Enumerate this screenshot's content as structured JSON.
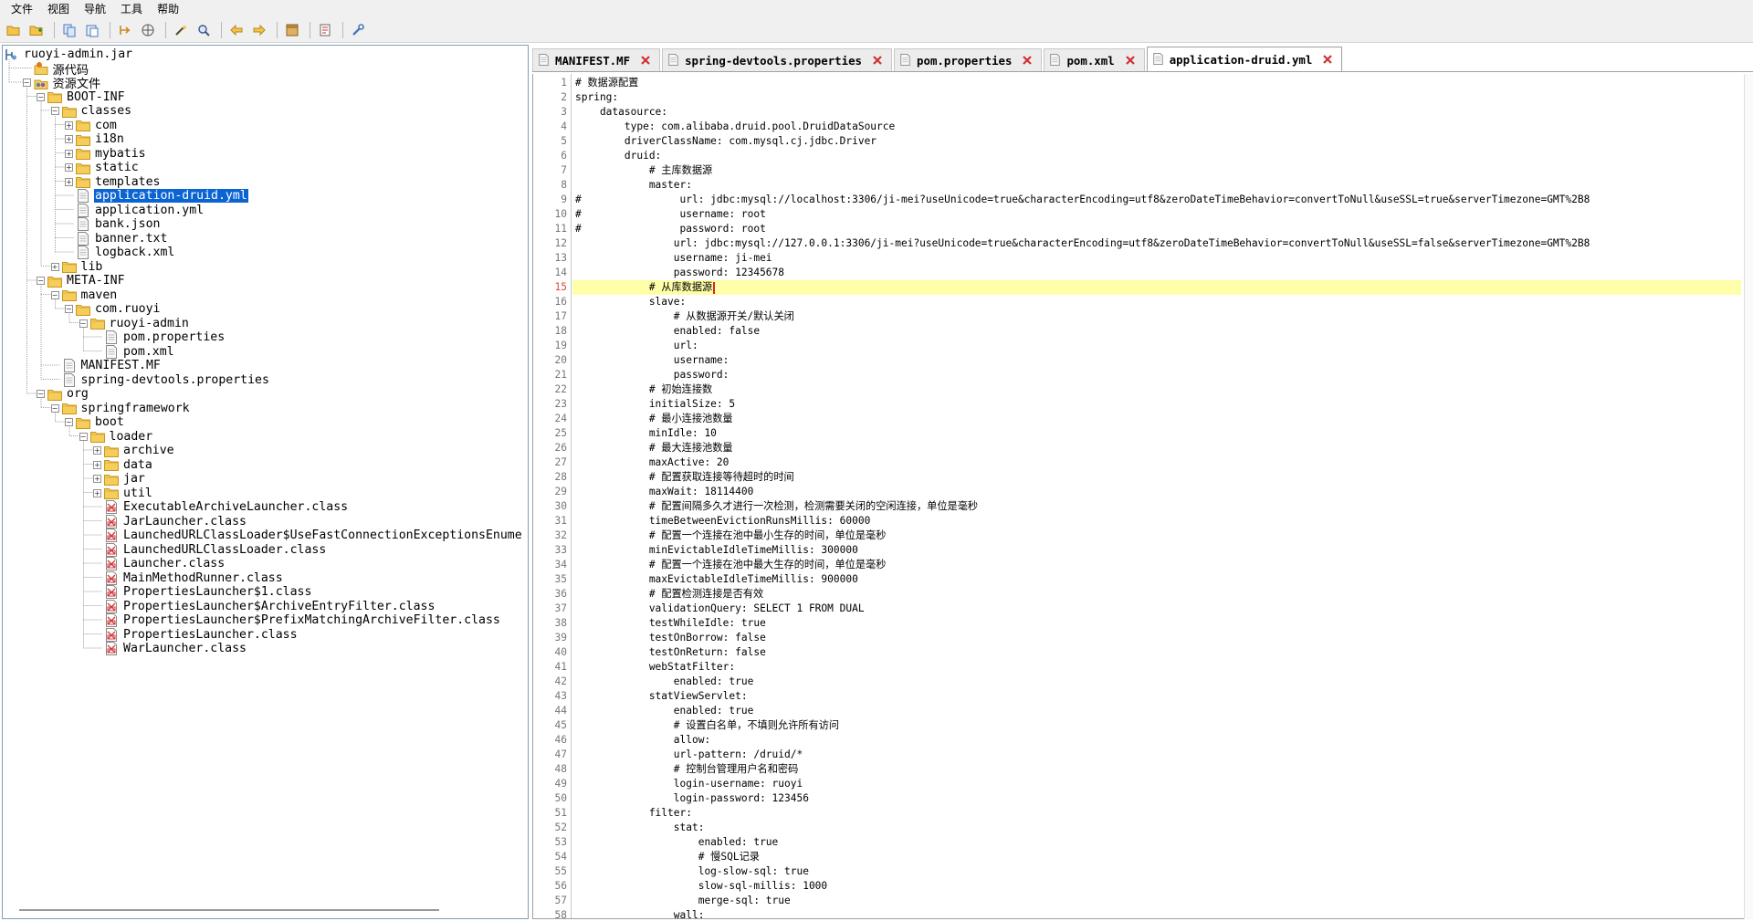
{
  "menubar": {
    "items": [
      "文件",
      "视图",
      "导航",
      "工具",
      "帮助"
    ]
  },
  "toolbar": {
    "buttons": [
      "open-folder-icon",
      "add-folder-icon",
      "copy-icon",
      "paste-icon",
      "back-nav-icon",
      "web-icon",
      "wand-icon",
      "search-icon",
      "arrow-left-icon",
      "arrow-right-icon",
      "archive-icon",
      "document-icon",
      "settings-icon"
    ]
  },
  "tree": {
    "nodes": [
      {
        "label": "ruoyi-admin.jar",
        "depth": 0,
        "icon": "jar-icon",
        "expander": ""
      },
      {
        "label": "源代码",
        "depth": 1,
        "icon": "source-package-icon",
        "expander": ""
      },
      {
        "label": "资源文件",
        "depth": 1,
        "icon": "resource-package-icon",
        "expander": "-"
      },
      {
        "label": "BOOT-INF",
        "depth": 2,
        "icon": "folder-icon",
        "expander": "-"
      },
      {
        "label": "classes",
        "depth": 3,
        "icon": "folder-icon",
        "expander": "-"
      },
      {
        "label": "com",
        "depth": 4,
        "icon": "folder-icon",
        "expander": "+"
      },
      {
        "label": "i18n",
        "depth": 4,
        "icon": "folder-icon",
        "expander": "+"
      },
      {
        "label": "mybatis",
        "depth": 4,
        "icon": "folder-icon",
        "expander": "+"
      },
      {
        "label": "static",
        "depth": 4,
        "icon": "folder-icon",
        "expander": "+"
      },
      {
        "label": "templates",
        "depth": 4,
        "icon": "folder-icon",
        "expander": "+"
      },
      {
        "label": "application-druid.yml",
        "depth": 4,
        "icon": "file-icon",
        "expander": "",
        "selected": true
      },
      {
        "label": "application.yml",
        "depth": 4,
        "icon": "file-icon",
        "expander": ""
      },
      {
        "label": "bank.json",
        "depth": 4,
        "icon": "file-icon",
        "expander": ""
      },
      {
        "label": "banner.txt",
        "depth": 4,
        "icon": "file-icon",
        "expander": ""
      },
      {
        "label": "logback.xml",
        "depth": 4,
        "icon": "file-icon",
        "expander": ""
      },
      {
        "label": "lib",
        "depth": 3,
        "icon": "folder-icon",
        "expander": "+"
      },
      {
        "label": "META-INF",
        "depth": 2,
        "icon": "folder-icon",
        "expander": "-"
      },
      {
        "label": "maven",
        "depth": 3,
        "icon": "folder-icon",
        "expander": "-"
      },
      {
        "label": "com.ruoyi",
        "depth": 4,
        "icon": "folder-icon",
        "expander": "-"
      },
      {
        "label": "ruoyi-admin",
        "depth": 5,
        "icon": "folder-icon",
        "expander": "-"
      },
      {
        "label": "pom.properties",
        "depth": 6,
        "icon": "file-icon",
        "expander": ""
      },
      {
        "label": "pom.xml",
        "depth": 6,
        "icon": "file-icon",
        "expander": ""
      },
      {
        "label": "MANIFEST.MF",
        "depth": 3,
        "icon": "file-icon",
        "expander": ""
      },
      {
        "label": "spring-devtools.properties",
        "depth": 3,
        "icon": "file-icon",
        "expander": ""
      },
      {
        "label": "org",
        "depth": 2,
        "icon": "folder-icon",
        "expander": "-"
      },
      {
        "label": "springframework",
        "depth": 3,
        "icon": "folder-icon",
        "expander": "-"
      },
      {
        "label": "boot",
        "depth": 4,
        "icon": "folder-icon",
        "expander": "-"
      },
      {
        "label": "loader",
        "depth": 5,
        "icon": "folder-icon",
        "expander": "-"
      },
      {
        "label": "archive",
        "depth": 6,
        "icon": "folder-icon",
        "expander": "+"
      },
      {
        "label": "data",
        "depth": 6,
        "icon": "folder-icon",
        "expander": "+"
      },
      {
        "label": "jar",
        "depth": 6,
        "icon": "folder-icon",
        "expander": "+"
      },
      {
        "label": "util",
        "depth": 6,
        "icon": "folder-icon",
        "expander": "+"
      },
      {
        "label": "ExecutableArchiveLauncher.class",
        "depth": 6,
        "icon": "class-file-icon",
        "expander": ""
      },
      {
        "label": "JarLauncher.class",
        "depth": 6,
        "icon": "class-file-icon",
        "expander": ""
      },
      {
        "label": "LaunchedURLClassLoader$UseFastConnectionExceptionsEnume",
        "depth": 6,
        "icon": "class-file-icon",
        "expander": ""
      },
      {
        "label": "LaunchedURLClassLoader.class",
        "depth": 6,
        "icon": "class-file-icon",
        "expander": ""
      },
      {
        "label": "Launcher.class",
        "depth": 6,
        "icon": "class-file-icon",
        "expander": ""
      },
      {
        "label": "MainMethodRunner.class",
        "depth": 6,
        "icon": "class-file-icon",
        "expander": ""
      },
      {
        "label": "PropertiesLauncher$1.class",
        "depth": 6,
        "icon": "class-file-icon",
        "expander": ""
      },
      {
        "label": "PropertiesLauncher$ArchiveEntryFilter.class",
        "depth": 6,
        "icon": "class-file-icon",
        "expander": ""
      },
      {
        "label": "PropertiesLauncher$PrefixMatchingArchiveFilter.class",
        "depth": 6,
        "icon": "class-file-icon",
        "expander": ""
      },
      {
        "label": "PropertiesLauncher.class",
        "depth": 6,
        "icon": "class-file-icon",
        "expander": ""
      },
      {
        "label": "WarLauncher.class",
        "depth": 6,
        "icon": "class-file-icon",
        "expander": ""
      }
    ]
  },
  "tabs": [
    {
      "label": "MANIFEST.MF",
      "active": false
    },
    {
      "label": "spring-devtools.properties",
      "active": false
    },
    {
      "label": "pom.properties",
      "active": false
    },
    {
      "label": "pom.xml",
      "active": false
    },
    {
      "label": "application-druid.yml",
      "active": true
    }
  ],
  "editor": {
    "current_line": 15,
    "lines": [
      "# 数据源配置",
      "spring:",
      "    datasource:",
      "        type: com.alibaba.druid.pool.DruidDataSource",
      "        driverClassName: com.mysql.cj.jdbc.Driver",
      "        druid:",
      "            # 主库数据源",
      "            master:",
      "#                url: jdbc:mysql://localhost:3306/ji-mei?useUnicode=true&characterEncoding=utf8&zeroDateTimeBehavior=convertToNull&useSSL=true&serverTimezone=GMT%2B8",
      "#                username: root",
      "#                password: root",
      "                url: jdbc:mysql://127.0.0.1:3306/ji-mei?useUnicode=true&characterEncoding=utf8&zeroDateTimeBehavior=convertToNull&useSSL=false&serverTimezone=GMT%2B8",
      "                username: ji-mei",
      "                password: 12345678",
      "            # 从库数据源",
      "            slave:",
      "                # 从数据源开关/默认关闭",
      "                enabled: false",
      "                url:",
      "                username:",
      "                password:",
      "            # 初始连接数",
      "            initialSize: 5",
      "            # 最小连接池数量",
      "            minIdle: 10",
      "            # 最大连接池数量",
      "            maxActive: 20",
      "            # 配置获取连接等待超时的时间",
      "            maxWait: 18114400",
      "            # 配置间隔多久才进行一次检测，检测需要关闭的空闲连接，单位是毫秒",
      "            timeBetweenEvictionRunsMillis: 60000",
      "            # 配置一个连接在池中最小生存的时间，单位是毫秒",
      "            minEvictableIdleTimeMillis: 300000",
      "            # 配置一个连接在池中最大生存的时间，单位是毫秒",
      "            maxEvictableIdleTimeMillis: 900000",
      "            # 配置检测连接是否有效",
      "            validationQuery: SELECT 1 FROM DUAL",
      "            testWhileIdle: true",
      "            testOnBorrow: false",
      "            testOnReturn: false",
      "            webStatFilter:",
      "                enabled: true",
      "            statViewServlet:",
      "                enabled: true",
      "                # 设置白名单，不填则允许所有访问",
      "                allow:",
      "                url-pattern: /druid/*",
      "                # 控制台管理用户名和密码",
      "                login-username: ruoyi",
      "                login-password: 123456",
      "            filter:",
      "                stat:",
      "                    enabled: true",
      "                    # 慢SQL记录",
      "                    log-slow-sql: true",
      "                    slow-sql-millis: 1000",
      "                    merge-sql: true",
      "                wall:"
    ]
  },
  "colors": {
    "selection": "#0a64d2",
    "current_line": "#ffffaa",
    "tab_close": "#d03030",
    "folder": "#f0c040"
  }
}
